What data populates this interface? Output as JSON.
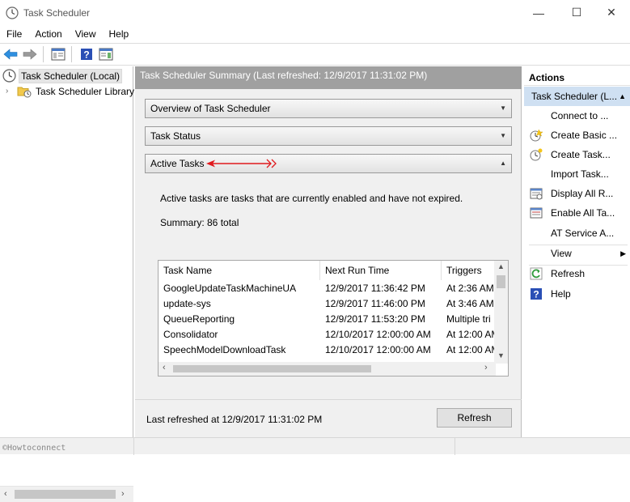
{
  "window": {
    "title": "Task Scheduler",
    "controls": {
      "minimize": "—",
      "maximize": "☐",
      "close": "✕"
    }
  },
  "menu": [
    "File",
    "Action",
    "View",
    "Help"
  ],
  "toolbar": {
    "icons": [
      "back-arrow-icon",
      "forward-arrow-icon",
      "console-tree-icon",
      "help-icon",
      "action-pane-icon"
    ]
  },
  "tree": {
    "root": "Task Scheduler (Local)",
    "child": "Task Scheduler Library"
  },
  "center": {
    "header": "Task Scheduler Summary (Last refreshed: 12/9/2017 11:31:02 PM)",
    "sections": [
      {
        "label": "Overview of Task Scheduler",
        "state": "collapsed"
      },
      {
        "label": "Task Status",
        "state": "collapsed"
      },
      {
        "label": "Active Tasks",
        "state": "expanded"
      }
    ],
    "active_desc": "Active tasks are tasks that are currently enabled and have not expired.",
    "summary": "Summary: 86 total",
    "table": {
      "columns": [
        "Task Name",
        "Next Run Time",
        "Triggers"
      ],
      "rows": [
        [
          "GoogleUpdateTaskMachineUA",
          "12/9/2017 11:36:42 PM",
          "At 2:36 AM"
        ],
        [
          "update-sys",
          "12/9/2017 11:46:00 PM",
          "At 3:46 AM"
        ],
        [
          "QueueReporting",
          "12/9/2017 11:53:20 PM",
          "Multiple tri"
        ],
        [
          "Consolidator",
          "12/10/2017 12:00:00 AM",
          "At 12:00 AM"
        ],
        [
          "SpeechModelDownloadTask",
          "12/10/2017 12:00:00 AM",
          "At 12:00 AM"
        ]
      ]
    },
    "footer_text": "Last refreshed at 12/9/2017 11:31:02 PM",
    "refresh_button": "Refresh"
  },
  "actions": {
    "header": "Actions",
    "group": "Task Scheduler (L...",
    "items": [
      {
        "label": "Connect to ...",
        "icon": "none"
      },
      {
        "label": "Create Basic ...",
        "icon": "create-basic-task-icon"
      },
      {
        "label": "Create Task...",
        "icon": "create-task-icon"
      },
      {
        "label": "Import Task...",
        "icon": "none"
      },
      {
        "label": "Display All R...",
        "icon": "display-running-icon"
      },
      {
        "label": "Enable All Ta...",
        "icon": "enable-history-icon"
      },
      {
        "label": "AT Service A...",
        "icon": "none"
      },
      {
        "label": "View",
        "icon": "none"
      },
      {
        "label": "Refresh",
        "icon": "refresh-icon"
      },
      {
        "label": "Help",
        "icon": "help-icon"
      }
    ]
  },
  "watermark": "©Howtoconnect",
  "colors": {
    "header_gray": "#a0a0a0",
    "actions_selected": "#cfe0f2",
    "arrow_red": "#e0191d",
    "help_blue": "#2a4fb5"
  }
}
